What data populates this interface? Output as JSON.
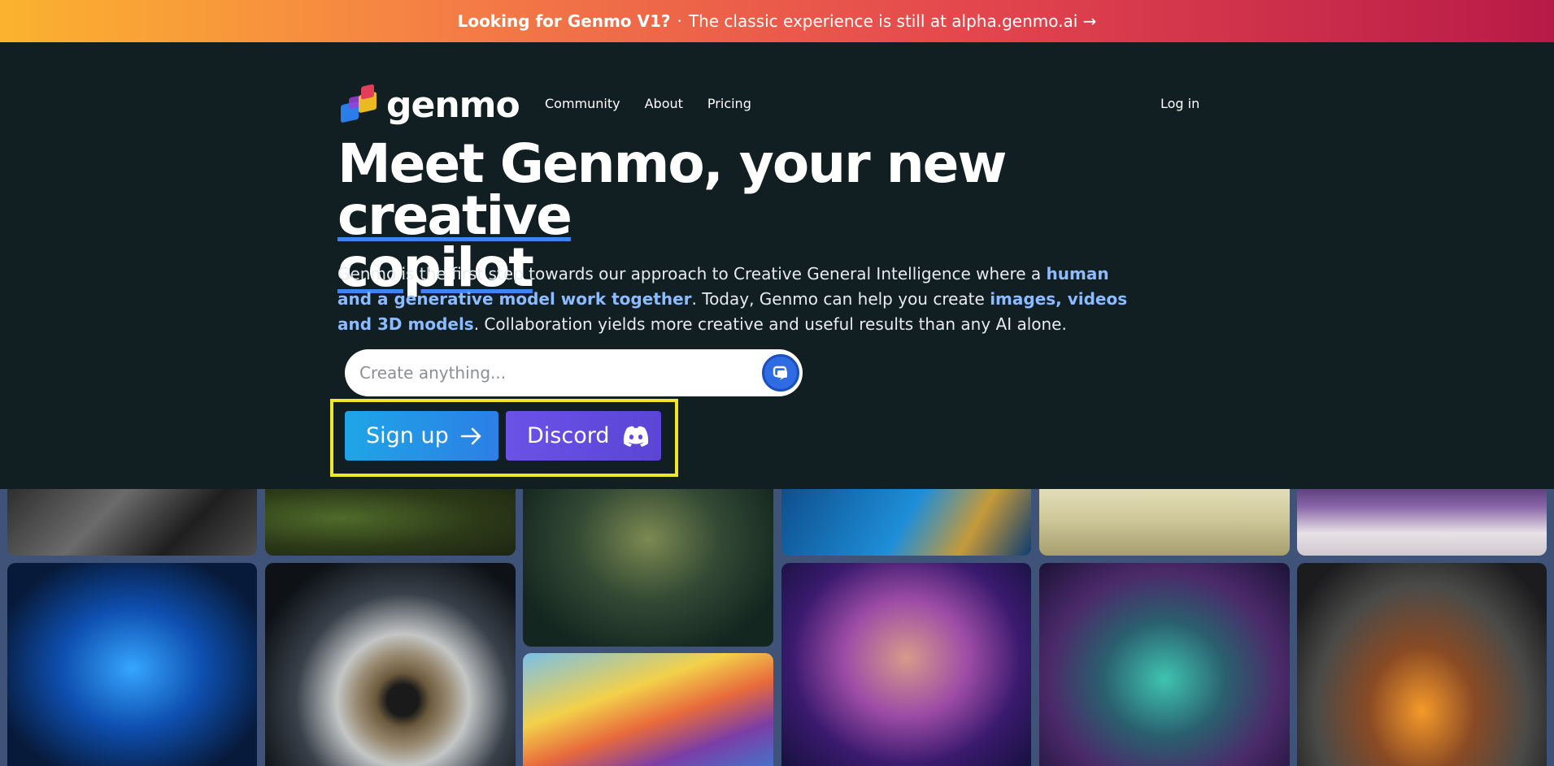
{
  "banner": {
    "bold": "Looking for Genmo V1?",
    "separator": "·",
    "text": "The classic experience is still at alpha.genmo.ai →"
  },
  "brand": {
    "name": "genmo"
  },
  "nav": {
    "items": [
      "Community",
      "About",
      "Pricing"
    ],
    "login": "Log in"
  },
  "hero": {
    "title_plain": "Meet Genmo, your new ",
    "title_ul1": "creative",
    "title_ul2": "copilot",
    "desc_1": "Genmo is the first step towards our approach to Creative General Intelligence where a ",
    "desc_hl1": "human and a generative model work together",
    "desc_2": ". Today, Genmo can help you create ",
    "desc_hl2": "images, videos and 3D models",
    "desc_3": ". Collaboration yields more creative and useful results than any AI alone."
  },
  "search": {
    "placeholder": "Create anything..."
  },
  "cta": {
    "signup": "Sign up",
    "discord": "Discord"
  },
  "gallery": {
    "images": [
      "ornate-carving",
      "mossy-forest",
      "cthulhu-monster",
      "blue-figure",
      "spiky-creatures",
      "purple-shoe",
      "blue-smoke-dragon",
      "closeup-eye",
      "hamster-sunglasses",
      "fairy-girl",
      "cyber-turtle",
      "skeleton-heart"
    ]
  },
  "colors": {
    "background": "#111e22",
    "accent_blue": "#3f84f2",
    "highlight_text": "#8cbbff",
    "gallery_bg": "#3e5377"
  }
}
